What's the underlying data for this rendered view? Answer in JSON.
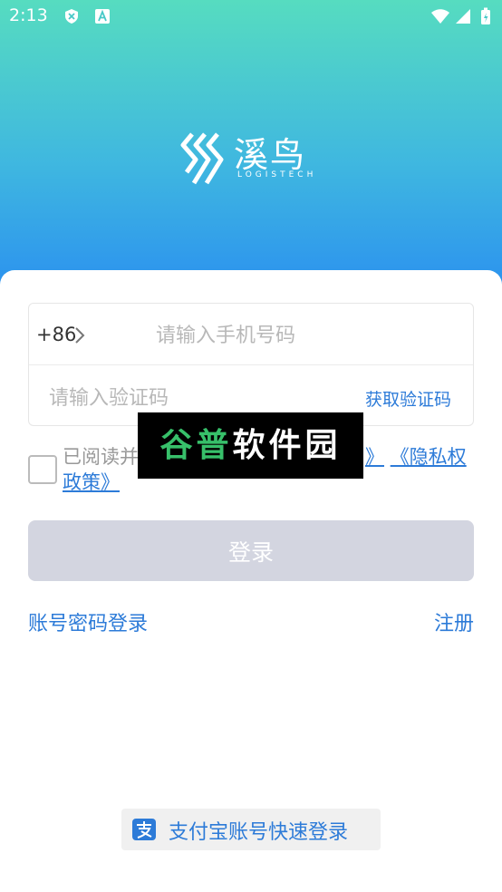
{
  "status_bar": {
    "time": "2:13"
  },
  "brand": {
    "name": "溪鸟",
    "tagline": "LOGISTECH"
  },
  "form": {
    "country_code": "+86",
    "phone_placeholder": "请输入手机号码",
    "code_placeholder": "请输入验证码",
    "get_code_label": "获取验证码"
  },
  "agreement": {
    "prefix": "已阅读并",
    "user_agreement_link": "》",
    "privacy_link": "《隐私权政策》"
  },
  "watermark": {
    "text_green": "谷普",
    "text_white": "软件园"
  },
  "actions": {
    "login_label": "登录",
    "password_login_label": "账号密码登录",
    "register_label": "注册",
    "alipay_login_label": "支付宝账号快速登录"
  },
  "colors": {
    "accent": "#2d7bd8",
    "header_top": "#56dcc0",
    "header_bottom": "#2a8ff0",
    "login_button_disabled": "#d3d5e0"
  }
}
